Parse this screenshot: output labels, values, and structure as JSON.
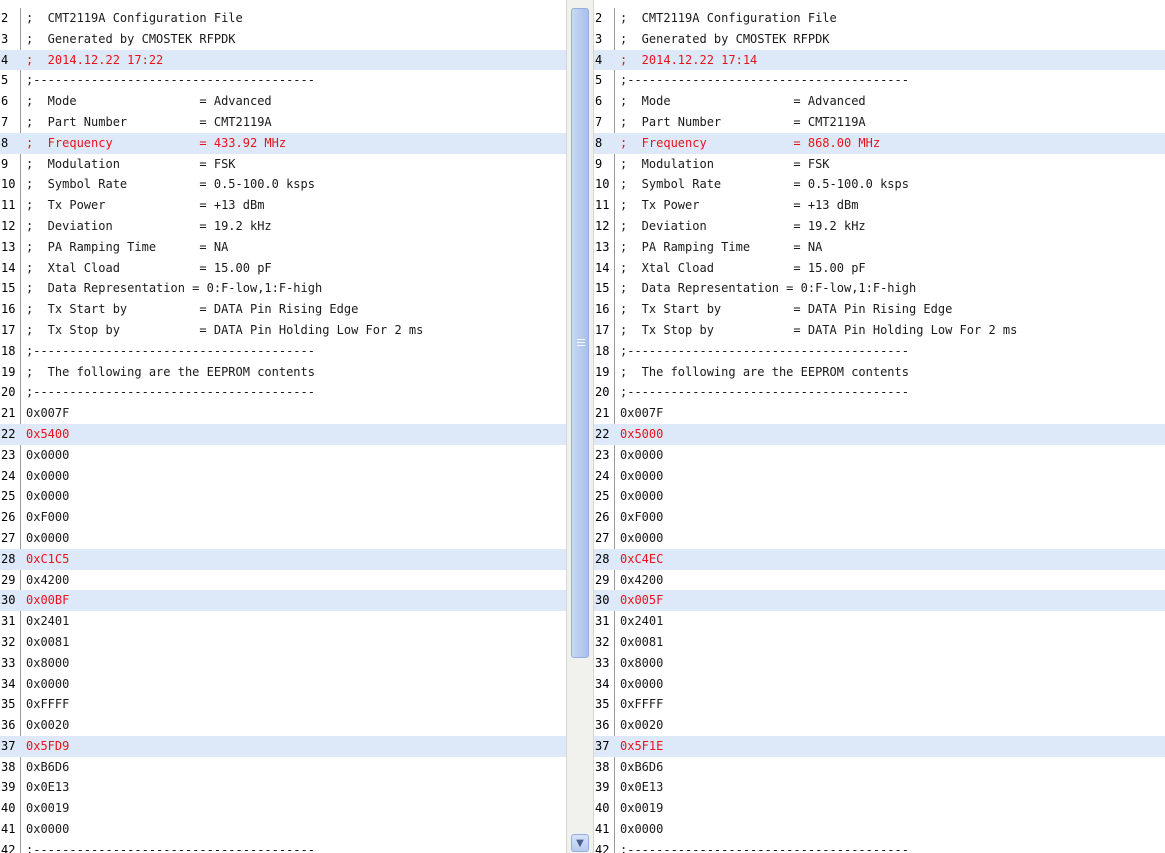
{
  "left_pane": {
    "lines": [
      {
        "n": "2",
        "t": ";  CMT2119A Configuration File",
        "d": false
      },
      {
        "n": "3",
        "t": ";  Generated by CMOSTEK RFPDK",
        "d": false
      },
      {
        "n": "4",
        "t": ";  2014.12.22 17:22",
        "d": true
      },
      {
        "n": "5",
        "t": ";---------------------------------------",
        "d": false
      },
      {
        "n": "6",
        "t": ";  Mode                 = Advanced",
        "d": false
      },
      {
        "n": "7",
        "t": ";  Part Number          = CMT2119A",
        "d": false
      },
      {
        "n": "8",
        "t": ";  Frequency            = 433.92 MHz",
        "d": true
      },
      {
        "n": "9",
        "t": ";  Modulation           = FSK",
        "d": false
      },
      {
        "n": "10",
        "t": ";  Symbol Rate          = 0.5-100.0 ksps",
        "d": false
      },
      {
        "n": "11",
        "t": ";  Tx Power             = +13 dBm",
        "d": false
      },
      {
        "n": "12",
        "t": ";  Deviation            = 19.2 kHz",
        "d": false
      },
      {
        "n": "13",
        "t": ";  PA Ramping Time      = NA",
        "d": false
      },
      {
        "n": "14",
        "t": ";  Xtal Cload           = 15.00 pF",
        "d": false
      },
      {
        "n": "15",
        "t": ";  Data Representation = 0:F-low,1:F-high",
        "d": false
      },
      {
        "n": "16",
        "t": ";  Tx Start by          = DATA Pin Rising Edge",
        "d": false
      },
      {
        "n": "17",
        "t": ";  Tx Stop by           = DATA Pin Holding Low For 2 ms",
        "d": false
      },
      {
        "n": "18",
        "t": ";---------------------------------------",
        "d": false
      },
      {
        "n": "19",
        "t": ";  The following are the EEPROM contents",
        "d": false
      },
      {
        "n": "20",
        "t": ";---------------------------------------",
        "d": false
      },
      {
        "n": "21",
        "t": "0x007F",
        "d": false
      },
      {
        "n": "22",
        "t": "0x5400",
        "d": true
      },
      {
        "n": "23",
        "t": "0x0000",
        "d": false
      },
      {
        "n": "24",
        "t": "0x0000",
        "d": false
      },
      {
        "n": "25",
        "t": "0x0000",
        "d": false
      },
      {
        "n": "26",
        "t": "0xF000",
        "d": false
      },
      {
        "n": "27",
        "t": "0x0000",
        "d": false
      },
      {
        "n": "28",
        "t": "0xC1C5",
        "d": true
      },
      {
        "n": "29",
        "t": "0x4200",
        "d": false
      },
      {
        "n": "30",
        "t": "0x00BF",
        "d": true
      },
      {
        "n": "31",
        "t": "0x2401",
        "d": false
      },
      {
        "n": "32",
        "t": "0x0081",
        "d": false
      },
      {
        "n": "33",
        "t": "0x8000",
        "d": false
      },
      {
        "n": "34",
        "t": "0x0000",
        "d": false
      },
      {
        "n": "35",
        "t": "0xFFFF",
        "d": false
      },
      {
        "n": "36",
        "t": "0x0020",
        "d": false
      },
      {
        "n": "37",
        "t": "0x5FD9",
        "d": true
      },
      {
        "n": "38",
        "t": "0xB6D6",
        "d": false
      },
      {
        "n": "39",
        "t": "0x0E13",
        "d": false
      },
      {
        "n": "40",
        "t": "0x0019",
        "d": false
      },
      {
        "n": "41",
        "t": "0x0000",
        "d": false
      },
      {
        "n": "42",
        "t": ";---------------------------------------",
        "d": false
      }
    ]
  },
  "right_pane": {
    "lines": [
      {
        "n": "2",
        "t": ";  CMT2119A Configuration File",
        "d": false
      },
      {
        "n": "3",
        "t": ";  Generated by CMOSTEK RFPDK",
        "d": false
      },
      {
        "n": "4",
        "t": ";  2014.12.22 17:14",
        "d": true
      },
      {
        "n": "5",
        "t": ";---------------------------------------",
        "d": false
      },
      {
        "n": "6",
        "t": ";  Mode                 = Advanced",
        "d": false
      },
      {
        "n": "7",
        "t": ";  Part Number          = CMT2119A",
        "d": false
      },
      {
        "n": "8",
        "t": ";  Frequency            = 868.00 MHz",
        "d": true
      },
      {
        "n": "9",
        "t": ";  Modulation           = FSK",
        "d": false
      },
      {
        "n": "10",
        "t": ";  Symbol Rate          = 0.5-100.0 ksps",
        "d": false
      },
      {
        "n": "11",
        "t": ";  Tx Power             = +13 dBm",
        "d": false
      },
      {
        "n": "12",
        "t": ";  Deviation            = 19.2 kHz",
        "d": false
      },
      {
        "n": "13",
        "t": ";  PA Ramping Time      = NA",
        "d": false
      },
      {
        "n": "14",
        "t": ";  Xtal Cload           = 15.00 pF",
        "d": false
      },
      {
        "n": "15",
        "t": ";  Data Representation = 0:F-low,1:F-high",
        "d": false
      },
      {
        "n": "16",
        "t": ";  Tx Start by          = DATA Pin Rising Edge",
        "d": false
      },
      {
        "n": "17",
        "t": ";  Tx Stop by           = DATA Pin Holding Low For 2 ms",
        "d": false
      },
      {
        "n": "18",
        "t": ";---------------------------------------",
        "d": false
      },
      {
        "n": "19",
        "t": ";  The following are the EEPROM contents",
        "d": false
      },
      {
        "n": "20",
        "t": ";---------------------------------------",
        "d": false
      },
      {
        "n": "21",
        "t": "0x007F",
        "d": false
      },
      {
        "n": "22",
        "t": "0x5000",
        "d": true
      },
      {
        "n": "23",
        "t": "0x0000",
        "d": false
      },
      {
        "n": "24",
        "t": "0x0000",
        "d": false
      },
      {
        "n": "25",
        "t": "0x0000",
        "d": false
      },
      {
        "n": "26",
        "t": "0xF000",
        "d": false
      },
      {
        "n": "27",
        "t": "0x0000",
        "d": false
      },
      {
        "n": "28",
        "t": "0xC4EC",
        "d": true
      },
      {
        "n": "29",
        "t": "0x4200",
        "d": false
      },
      {
        "n": "30",
        "t": "0x005F",
        "d": true
      },
      {
        "n": "31",
        "t": "0x2401",
        "d": false
      },
      {
        "n": "32",
        "t": "0x0081",
        "d": false
      },
      {
        "n": "33",
        "t": "0x8000",
        "d": false
      },
      {
        "n": "34",
        "t": "0x0000",
        "d": false
      },
      {
        "n": "35",
        "t": "0xFFFF",
        "d": false
      },
      {
        "n": "36",
        "t": "0x0020",
        "d": false
      },
      {
        "n": "37",
        "t": "0x5F1E",
        "d": true
      },
      {
        "n": "38",
        "t": "0xB6D6",
        "d": false
      },
      {
        "n": "39",
        "t": "0x0E13",
        "d": false
      },
      {
        "n": "40",
        "t": "0x0019",
        "d": false
      },
      {
        "n": "41",
        "t": "0x0000",
        "d": false
      },
      {
        "n": "42",
        "t": ";---------------------------------------",
        "d": false
      }
    ]
  },
  "scrollbar": {
    "down_icon": "chevron-down-icon",
    "down_glyph": "▼"
  },
  "colors": {
    "diff_bg": "#dde9f8",
    "diff_text": "#e8121c"
  }
}
